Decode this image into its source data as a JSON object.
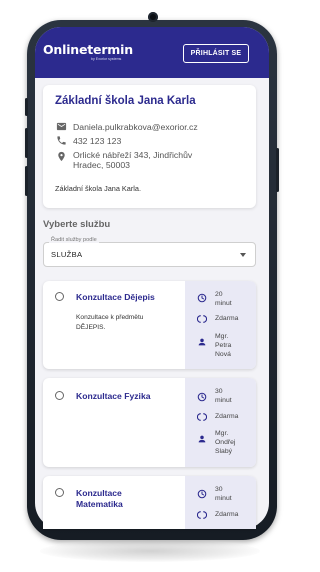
{
  "header": {
    "logo_text": "Onlinetermin",
    "logo_subtext": "by Exorior systems",
    "login_label": "PŘIHLÁSIT SE"
  },
  "organization": {
    "name": "Základní škola Jana Karla",
    "email": "Daniela.pulkrabkova@exorior.cz",
    "phone": "432 123 123",
    "address_line1": "Orlické nábřeží 343, Jindřichův",
    "address_line2": "Hradec, 50003",
    "description": "Základní škola Jana Karla."
  },
  "services_section": {
    "title": "Vyberte službu",
    "sort": {
      "legend": "Řadit služby podle",
      "selected": "SLUŽBA"
    }
  },
  "services": [
    {
      "name_line1": "Konzultace Dějepis",
      "name_line2": "",
      "desc_line1": "Konzultace k předmětu",
      "desc_line2": "DĚJEPIS.",
      "duration_line1": "20",
      "duration_line2": "minut",
      "price": "Zdarma",
      "staff_line1": "Mgr.",
      "staff_line2": "Petra",
      "staff_line3": "Nová"
    },
    {
      "name_line1": "Konzultace Fyzika",
      "name_line2": "",
      "desc_line1": "",
      "desc_line2": "",
      "duration_line1": "30",
      "duration_line2": "minut",
      "price": "Zdarma",
      "staff_line1": "Mgr.",
      "staff_line2": "Ondřej",
      "staff_line3": "Slabý"
    },
    {
      "name_line1": "Konzultace",
      "name_line2": "Matematika",
      "desc_line1": "",
      "desc_line2": "",
      "duration_line1": "30",
      "duration_line2": "minut",
      "price": "Zdarma",
      "staff_line1": "",
      "staff_line2": "",
      "staff_line3": ""
    }
  ],
  "colors": {
    "brand": "#2c2a8e",
    "background": "#f3f3f7",
    "service_side": "#e9e9f5"
  },
  "icons": {
    "email": "mail-icon",
    "phone": "phone-icon",
    "address": "location-pin-icon",
    "duration": "clock-icon",
    "price": "price-tag-icon",
    "staff": "person-icon"
  }
}
